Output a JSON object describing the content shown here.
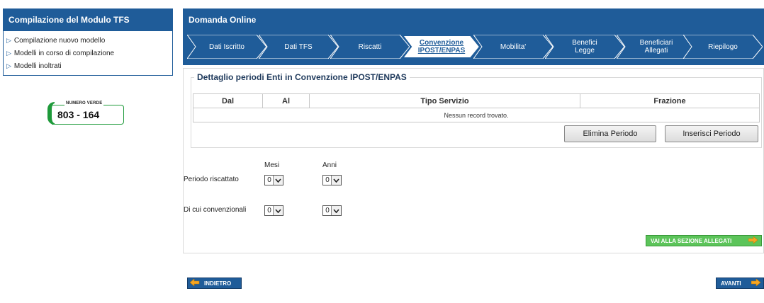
{
  "sidebar": {
    "title": "Compilazione del Modulo TFS",
    "items": [
      {
        "label": "Compilazione nuovo modello"
      },
      {
        "label": "Modelli in corso di compilazione"
      },
      {
        "label": "Modelli inoltrati"
      }
    ],
    "numero_verde": {
      "caption": "NUMERO VERDE",
      "number": "803 - 164"
    }
  },
  "main": {
    "title": "Domanda Online",
    "steps": [
      {
        "line1": "Dati Iscritto",
        "line2": ""
      },
      {
        "line1": "Dati TFS",
        "line2": ""
      },
      {
        "line1": "Riscatti",
        "line2": ""
      },
      {
        "line1": "Convenzione",
        "line2": "IPOST/ENPAS"
      },
      {
        "line1": "Mobilita'",
        "line2": ""
      },
      {
        "line1": "Benefici",
        "line2": "Legge"
      },
      {
        "line1": "Beneficiari",
        "line2": "Allegati"
      },
      {
        "line1": "Riepilogo",
        "line2": ""
      }
    ],
    "active_step": 3,
    "section": {
      "legend": "Dettaglio periodi Enti in Convenzione IPOST/ENPAS",
      "columns": [
        "Dal",
        "Al",
        "Tipo Servizio",
        "Frazione"
      ],
      "empty_message": "Nessun record trovato.",
      "delete_button": "Elimina Periodo",
      "insert_button": "Inserisci Periodo"
    },
    "form": {
      "mesi_label": "Mesi",
      "anni_label": "Anni",
      "rows": [
        {
          "label": "Periodo riscattato",
          "mesi": "0",
          "anni": "0"
        },
        {
          "label": "Di cui convenzionali",
          "mesi": "0",
          "anni": "0"
        }
      ]
    },
    "allegati_button": "VAI ALLA SEZIONE ALLEGATI",
    "back_button": "INDIETRO",
    "next_button": "AVANTI"
  },
  "colors": {
    "primary": "#1f5c99",
    "green": "#5cc45a",
    "arrow_orange": "#f5a623"
  }
}
